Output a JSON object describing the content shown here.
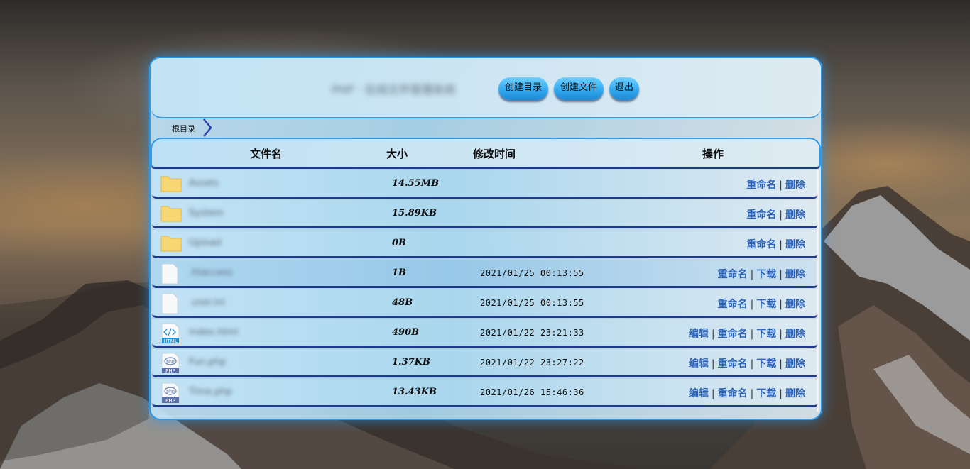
{
  "header": {
    "site_title": "PHP · 在线文件管理系统",
    "buttons": [
      {
        "label": "创建目录"
      },
      {
        "label": "创建文件"
      },
      {
        "label": "退出"
      }
    ]
  },
  "breadcrumb": {
    "root_label": "根目录"
  },
  "table": {
    "columns": [
      "文件名",
      "大小",
      "修改时间",
      "操作"
    ],
    "rows": [
      {
        "type": "folder",
        "name": "Assets",
        "size": "14.55MB",
        "modified": "",
        "ops": [
          "重命名",
          "删除"
        ]
      },
      {
        "type": "folder",
        "name": "System",
        "size": "15.89KB",
        "modified": "",
        "ops": [
          "重命名",
          "删除"
        ]
      },
      {
        "type": "folder",
        "name": "Upload",
        "size": "0B",
        "modified": "",
        "ops": [
          "重命名",
          "删除"
        ]
      },
      {
        "type": "file",
        "name": ".htaccess",
        "size": "1B",
        "modified": "2021/01/25 00:13:55",
        "ops": [
          "重命名",
          "下载",
          "删除"
        ]
      },
      {
        "type": "file",
        "name": ".user.ini",
        "size": "48B",
        "modified": "2021/01/25 00:13:55",
        "ops": [
          "重命名",
          "下载",
          "删除"
        ]
      },
      {
        "type": "html",
        "name": "index.html",
        "size": "490B",
        "modified": "2021/01/22 23:21:33",
        "ops": [
          "编辑",
          "重命名",
          "下载",
          "删除"
        ]
      },
      {
        "type": "php",
        "name": "Fun.php",
        "size": "1.37KB",
        "modified": "2021/01/22 23:27:22",
        "ops": [
          "编辑",
          "重命名",
          "下载",
          "删除"
        ]
      },
      {
        "type": "php",
        "name": "Time.php",
        "size": "13.43KB",
        "modified": "2021/01/26 15:46:36",
        "ops": [
          "编辑",
          "重命名",
          "下载",
          "删除"
        ]
      }
    ],
    "separator": "|"
  },
  "icons": {
    "folder": "folder-icon",
    "file": "file-icon",
    "html": "html-file-icon",
    "php": "php-file-icon",
    "html_badge": "HTML",
    "php_badge": "PHP",
    "php_logo": "php"
  },
  "colors": {
    "accent": "#2f9be8",
    "op_link": "#2c63b8",
    "row_rule": "#1e3a8a",
    "folder": "#f7d774"
  }
}
